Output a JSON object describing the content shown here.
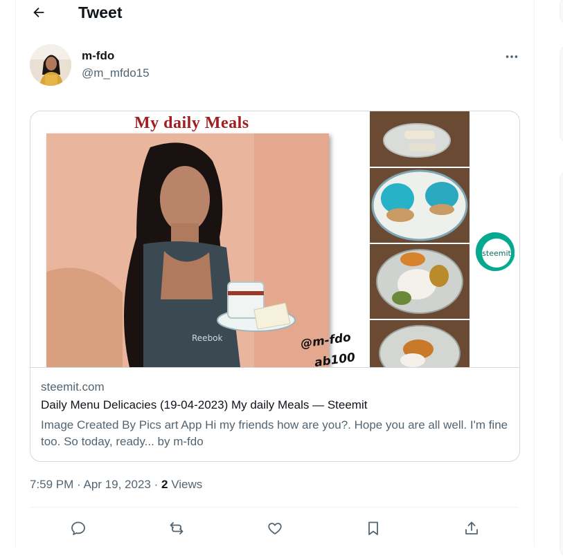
{
  "header": {
    "title": "Tweet",
    "back_icon": "arrow-left-icon"
  },
  "author": {
    "name": "m-fdo",
    "handle": "@m_mfdo15"
  },
  "more_icon": "more-horizontal-icon",
  "card": {
    "media_title": "My daily Meals",
    "watermark_line1": "@m-fdo",
    "watermark_line2": "ab100",
    "logo_text": "steemit",
    "domain": "steemit.com",
    "title": "Daily Menu Delicacies (19-04-2023) My daily Meals — Steemit",
    "description": "Image Created By Pics art App Hi my friends how are you?. Hope you are all well. I'm fine too. So today, ready... by m-fdo"
  },
  "meta": {
    "time": "7:59 PM",
    "date": "Apr 19, 2023",
    "views_count": "2",
    "views_label": "Views"
  },
  "actions": [
    "reply-icon",
    "retweet-icon",
    "like-icon",
    "bookmark-icon",
    "share-icon"
  ],
  "colors": {
    "accent_title": "#a01d20",
    "steemit_green": "#07b49a",
    "muted": "#536471"
  }
}
